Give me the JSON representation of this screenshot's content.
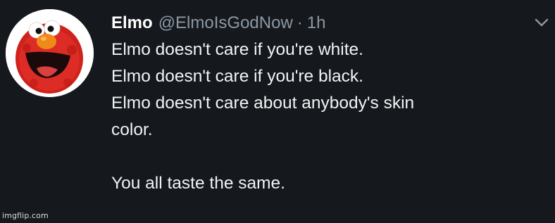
{
  "tweet": {
    "display_name": "Elmo",
    "handle": "@ElmoIsGodNow",
    "separator": "·",
    "time": "1h",
    "avatar_icon": "elmo-avatar-icon",
    "menu_icon": "chevron-down-icon",
    "lines": [
      "Elmo doesn't care if you're white.",
      "Elmo doesn't care if you're black.",
      "Elmo doesn't care about anybody's skin",
      "color.",
      "",
      "You all taste the same."
    ]
  },
  "watermark": "imgflip.com",
  "colors": {
    "background": "#15181c",
    "text": "#f1f3f5",
    "secondary_text": "#8b98a5",
    "elmo_red": "#d7261e"
  }
}
